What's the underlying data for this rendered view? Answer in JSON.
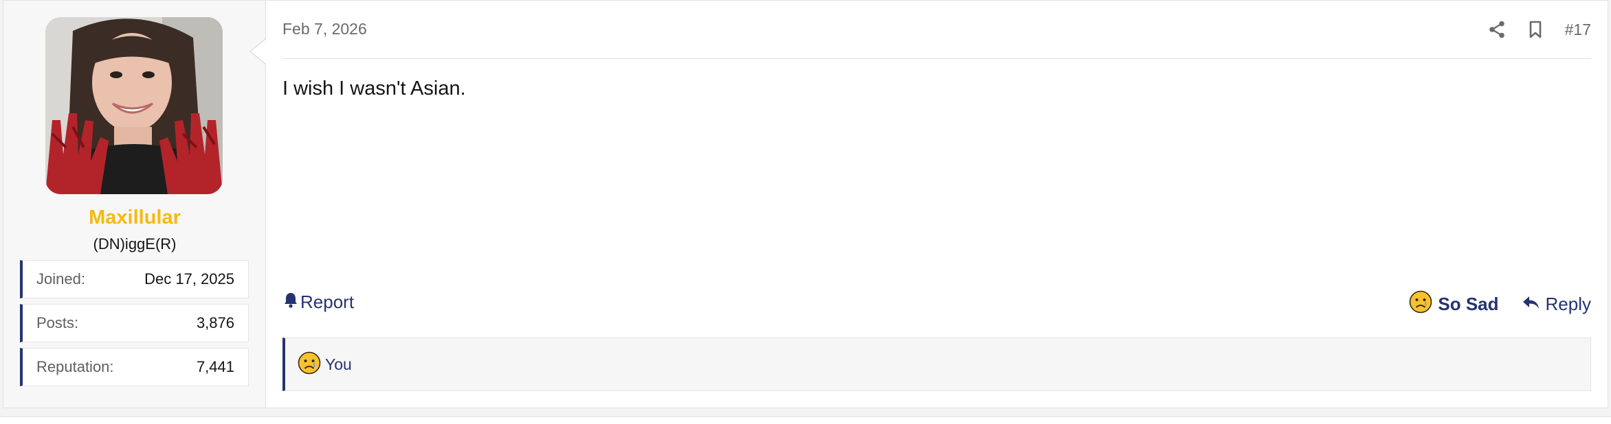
{
  "user": {
    "name": "Maxillular",
    "title": "(DN)iggE(R)",
    "name_color": "#f7b912",
    "avatar": "avatar-photo",
    "stats": [
      {
        "label": "Joined:",
        "value": "Dec 17, 2025"
      },
      {
        "label": "Posts:",
        "value": "3,876"
      },
      {
        "label": "Reputation:",
        "value": "7,441"
      }
    ]
  },
  "post": {
    "date": "Feb 7, 2026",
    "number": "#17",
    "body": "I wish I wasn't Asian.",
    "header_icons": [
      "share-icon",
      "bookmark-icon"
    ]
  },
  "actions": {
    "report_label": "Report",
    "reaction_label": "So Sad",
    "reply_label": "Reply",
    "report_icon": "bell-icon",
    "reaction_icon": "sad-face-icon",
    "reply_icon": "reply-arrow-icon"
  },
  "reactions": {
    "who": "You",
    "icon": "sad-face-icon"
  },
  "colors": {
    "accent": "#25336e",
    "username": "#f7b912"
  }
}
